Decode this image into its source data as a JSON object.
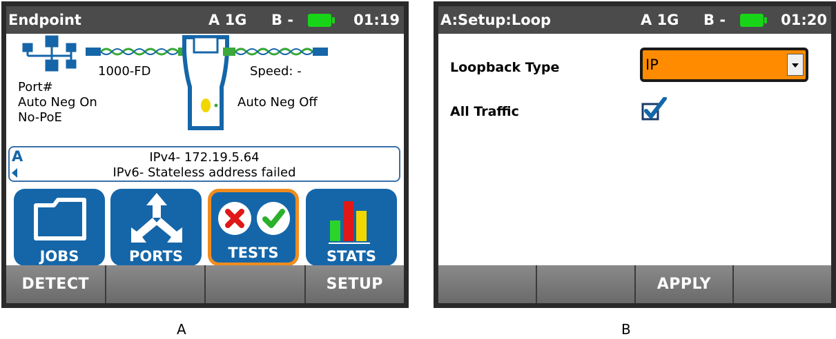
{
  "panel_a": {
    "status": {
      "title": "Endpoint",
      "port_a": "A 1G",
      "port_b": "B -",
      "time": "01:19"
    },
    "link": {
      "speed_left": "1000-FD",
      "speed_right": "Speed: -",
      "port_label": "Port#",
      "auto_neg_left": "Auto Neg On",
      "poe": "No-PoE",
      "auto_neg_right": "Auto Neg Off"
    },
    "ip_box": {
      "port_letter": "A",
      "ipv4": "IPv4- 172.19.5.64",
      "ipv6": "IPv6- Stateless address failed"
    },
    "tiles": [
      {
        "label": "JOBS",
        "icon": "folder-icon"
      },
      {
        "label": "PORTS",
        "icon": "ports-arrows-icon"
      },
      {
        "label": "TESTS",
        "icon": "tests-pass-fail-icon",
        "selected": true
      },
      {
        "label": "STATS",
        "icon": "bar-chart-icon"
      }
    ],
    "softkeys": [
      "DETECT",
      "",
      "",
      "SETUP"
    ]
  },
  "panel_b": {
    "status": {
      "title": "A:Setup:Loop",
      "port_a": "A 1G",
      "port_b": "B -",
      "time": "01:20"
    },
    "loopback_type": {
      "label": "Loopback Type",
      "value": "IP"
    },
    "all_traffic": {
      "label": "All Traffic",
      "checked": true
    },
    "softkeys": [
      "",
      "",
      "APPLY",
      ""
    ]
  },
  "captions": {
    "a": "A",
    "b": "B"
  },
  "colors": {
    "statusbar": "#4b4b4b",
    "tile_blue": "#1566a8",
    "accent_orange": "#ff8c00",
    "battery_green": "#18d418"
  }
}
